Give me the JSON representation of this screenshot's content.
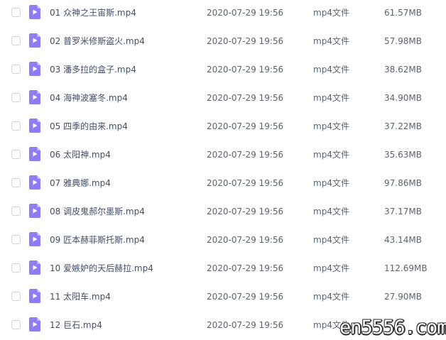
{
  "files": [
    {
      "name": "01 众神之王宙斯.mp4",
      "date": "2020-07-29 19:56",
      "type": "mp4文件",
      "size": "61.57MB",
      "icon": "video-file-icon"
    },
    {
      "name": "02 普罗米修斯盗火.mp4",
      "date": "2020-07-29 19:56",
      "type": "mp4文件",
      "size": "57.98MB",
      "icon": "video-file-icon"
    },
    {
      "name": "03 潘多拉的盒子.mp4",
      "date": "2020-07-29 19:56",
      "type": "mp4文件",
      "size": "38.62MB",
      "icon": "video-file-icon"
    },
    {
      "name": "04 海神波塞冬.mp4",
      "date": "2020-07-29 19:56",
      "type": "mp4文件",
      "size": "34.90MB",
      "icon": "video-file-icon"
    },
    {
      "name": "05 四季的由来.mp4",
      "date": "2020-07-29 19:56",
      "type": "mp4文件",
      "size": "37.22MB",
      "icon": "video-file-icon"
    },
    {
      "name": "06 太阳神.mp4",
      "date": "2020-07-29 19:56",
      "type": "mp4文件",
      "size": "35.63MB",
      "icon": "video-file-icon"
    },
    {
      "name": "07 雅典娜.mp4",
      "date": "2020-07-29 19:56",
      "type": "mp4文件",
      "size": "97.86MB",
      "icon": "video-file-icon"
    },
    {
      "name": "08 调皮鬼郝尔墨斯.mp4",
      "date": "2020-07-29 19:56",
      "type": "mp4文件",
      "size": "37.17MB",
      "icon": "video-file-icon"
    },
    {
      "name": "09 匠本赫菲斯托斯.mp4",
      "date": "2020-07-29 19:56",
      "type": "mp4文件",
      "size": "43.14MB",
      "icon": "video-file-icon"
    },
    {
      "name": "10 爱嫉妒的天后赫拉.mp4",
      "date": "2020-07-29 19:56",
      "type": "mp4文件",
      "size": "112.69MB",
      "icon": "video-file-icon"
    },
    {
      "name": "11 太阳车.mp4",
      "date": "2020-07-29 19:56",
      "type": "mp4文件",
      "size": "27.90MB",
      "icon": "video-file-icon"
    },
    {
      "name": "12 巨石.mp4",
      "date": "2020-07-29 19:56",
      "type": "mp4文件",
      "size": "",
      "icon": "video-file-icon"
    }
  ],
  "watermark": "en5556.com",
  "colors": {
    "icon_fill": "#8d7cf5",
    "icon_fold": "#bdb2ff",
    "text": "#424e67",
    "checkbox_border": "#d6d6d6"
  }
}
